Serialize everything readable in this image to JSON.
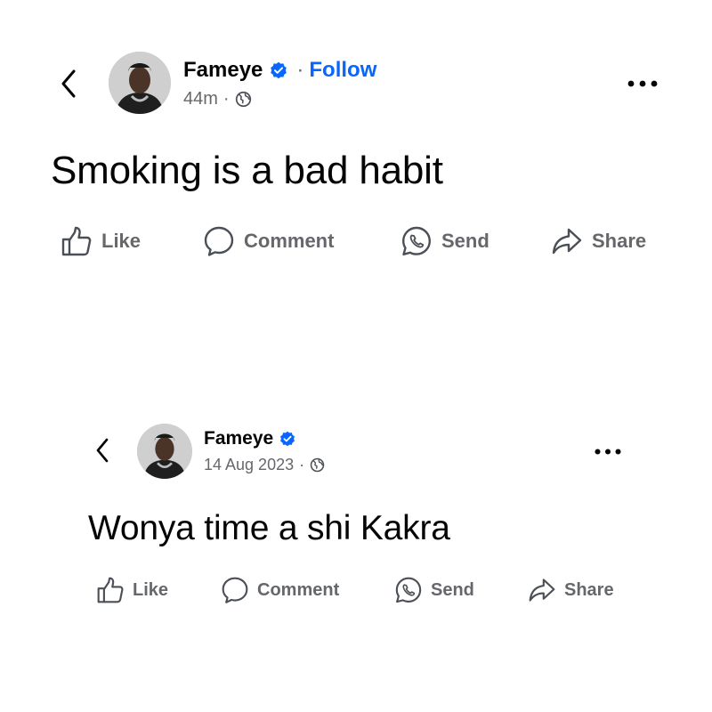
{
  "posts": [
    {
      "author": "Fameye",
      "verified": true,
      "follow_label": "Follow",
      "separator": "·",
      "timestamp": "44m",
      "audience_icon": "globe-icon",
      "text": "Smoking is a bad habit",
      "actions": {
        "like": "Like",
        "comment": "Comment",
        "send": "Send",
        "share": "Share"
      }
    },
    {
      "author": "Fameye",
      "verified": true,
      "separator": "·",
      "timestamp": "14 Aug 2023",
      "audience_icon": "globe-icon",
      "text": "Wonya time a shi Kakra",
      "actions": {
        "like": "Like",
        "comment": "Comment",
        "send": "Send",
        "share": "Share"
      }
    }
  ],
  "colors": {
    "verified": "#0866ff",
    "follow": "#0866ff",
    "secondary_text": "#65676b",
    "primary_text": "#050505"
  }
}
